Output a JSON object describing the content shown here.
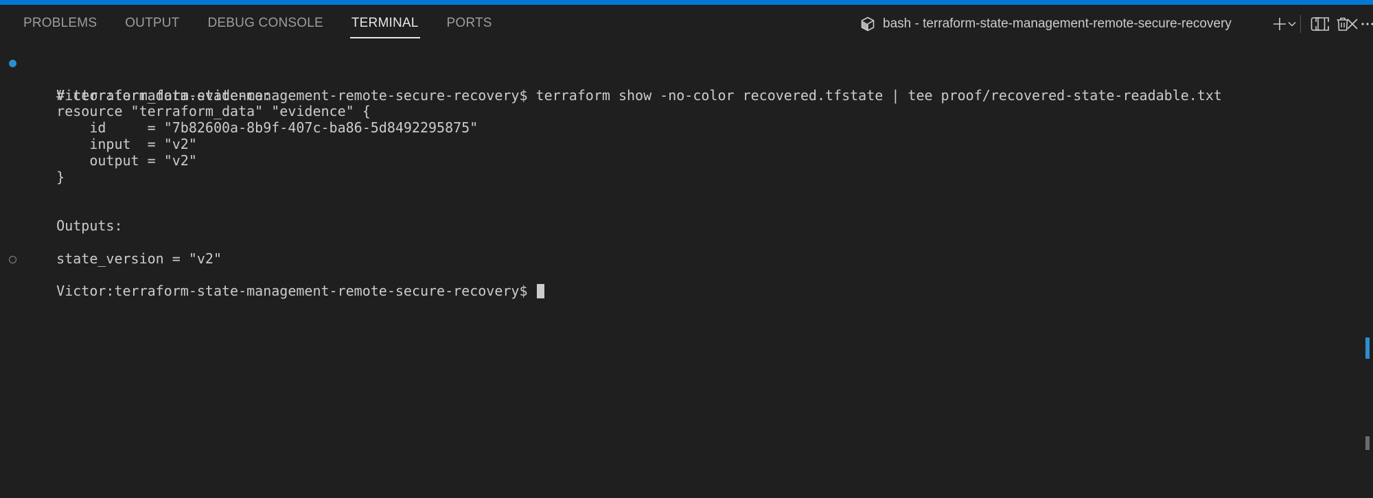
{
  "panel": {
    "tabs": [
      {
        "label": "PROBLEMS",
        "active": false
      },
      {
        "label": "OUTPUT",
        "active": false
      },
      {
        "label": "DEBUG CONSOLE",
        "active": false
      },
      {
        "label": "TERMINAL",
        "active": true
      },
      {
        "label": "PORTS",
        "active": false
      }
    ],
    "terminal_title": "bash - terraform-state-management-remote-secure-recovery",
    "toolbar_icons": [
      "new-terminal-icon",
      "launch-profile-chevron-icon",
      "split-terminal-icon",
      "kill-terminal-trash-icon",
      "more-actions-icon",
      "maximize-panel-icon",
      "close-panel-icon"
    ]
  },
  "terminal": {
    "lines": [
      "Victor:terraform-state-management-remote-secure-recovery$ terraform show -no-color recovered.tfstate | tee proof/recovered-state-readable.txt",
      "# terraform_data.evidence:",
      "resource \"terraform_data\" \"evidence\" {",
      "    id     = \"7b82600a-8b9f-407c-ba86-5d8492295875\"",
      "    input  = \"v2\"",
      "    output = \"v2\"",
      "}",
      "",
      "",
      "Outputs:",
      "",
      "state_version = \"v2\"",
      "Victor:terraform-state-management-remote-secure-recovery$ "
    ],
    "decorations": {
      "0": "success",
      "12": "empty"
    }
  },
  "colors": {
    "accent_bar": "#0078d4",
    "background": "#1f1f1f",
    "text": "#cccccc",
    "success_decoration": "#2a8ecf"
  }
}
